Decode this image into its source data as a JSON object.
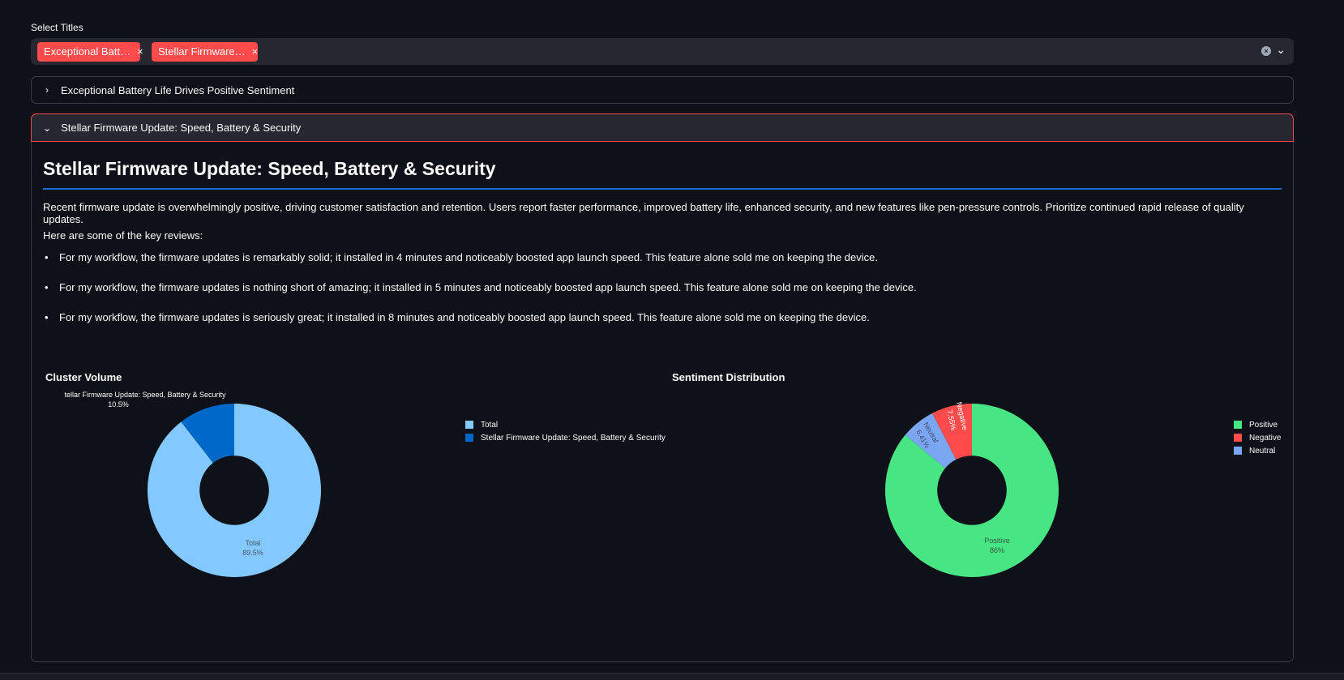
{
  "select": {
    "label": "Select Titles",
    "chips": [
      "Exceptional Batt…",
      "Stellar Firmware…"
    ],
    "chip_remove": "×",
    "clear_icon": "×",
    "chevron": "⌄"
  },
  "expanders": [
    {
      "title": "Exceptional Battery Life Drives Positive Sentiment",
      "expanded": false,
      "chevron": "›"
    },
    {
      "title": "Stellar Firmware Update: Speed, Battery & Security",
      "expanded": true,
      "chevron": "⌄"
    }
  ],
  "content": {
    "heading": "Stellar Firmware Update: Speed, Battery & Security",
    "summary": "Recent firmware update is overwhelmingly positive, driving customer satisfaction and retention. Users report faster performance, improved battery life, enhanced security, and new features like pen-pressure controls. Prioritize continued rapid release of quality updates.",
    "key_reviews_label": "Here are some of the key reviews:",
    "reviews": [
      "For my workflow, the firmware updates is remarkably solid; it installed in 4 minutes and noticeably boosted app launch speed. This feature alone sold me on keeping the device.",
      "For my workflow, the firmware updates is nothing short of amazing; it installed in 5 minutes and noticeably boosted app launch speed. This feature alone sold me on keeping the device.",
      "For my workflow, the firmware updates is seriously great; it installed in 8 minutes and noticeably boosted app launch speed. This feature alone sold me on keeping the device."
    ]
  },
  "colors": {
    "accent": "#ff4b4b",
    "total": "#83c9ff",
    "cluster": "#0068c9",
    "positive": "#47e583",
    "negative": "#ff4b4b",
    "neutral": "#7ba7f2"
  },
  "chart_data": [
    {
      "type": "pie",
      "title": "Cluster Volume",
      "hole": 0.4,
      "categories": [
        "Total",
        "Stellar Firmware Update: Speed, Battery & Security"
      ],
      "values": [
        89.5,
        10.5
      ],
      "labels": [
        "Total",
        "tellar Firmware Update: Speed, Battery & Security"
      ],
      "percent_labels": [
        "89.5%",
        "10.5%"
      ],
      "legend": [
        "Total",
        "Stellar Firmware Update: Speed, Battery & Security"
      ],
      "legend_position": "right"
    },
    {
      "type": "pie",
      "title": "Sentiment Distribution",
      "hole": 0.4,
      "categories": [
        "Positive",
        "Negative",
        "Neutral"
      ],
      "values": [
        86,
        7.55,
        6.41
      ],
      "percent_labels": [
        "86%",
        "7.55%",
        "6.41%"
      ],
      "legend": [
        "Positive",
        "Negative",
        "Neutral"
      ],
      "legend_position": "right"
    }
  ]
}
